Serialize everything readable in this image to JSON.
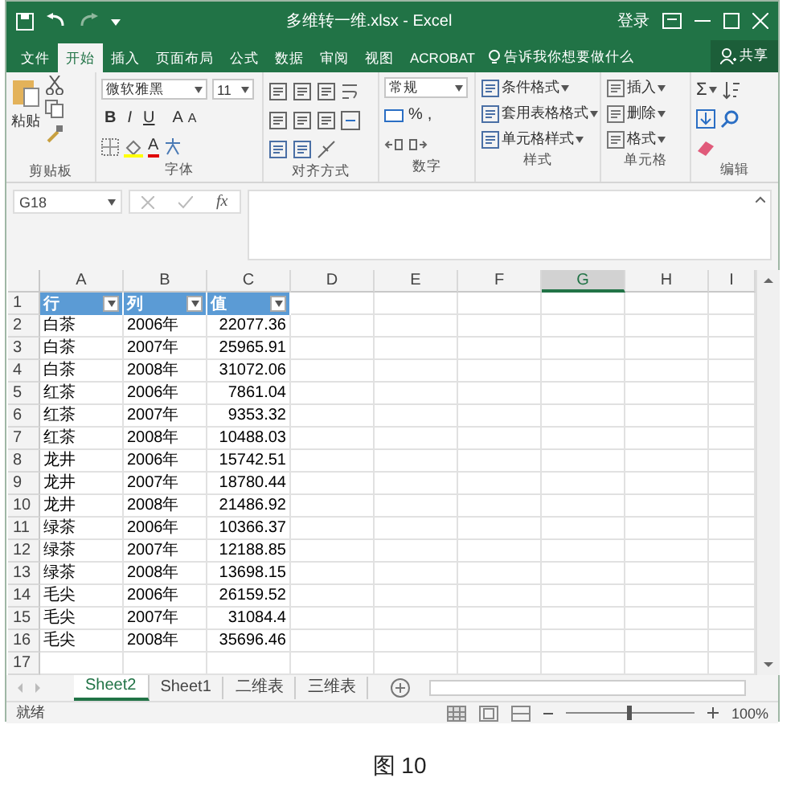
{
  "window": {
    "title": "多维转一维.xlsx - Excel",
    "sign_in": "登录"
  },
  "ribbon_tabs": [
    {
      "label": "文件",
      "selected": false
    },
    {
      "label": "开始",
      "selected": true
    },
    {
      "label": "插入",
      "selected": false
    },
    {
      "label": "页面布局",
      "selected": false
    },
    {
      "label": "公式",
      "selected": false
    },
    {
      "label": "数据",
      "selected": false
    },
    {
      "label": "审阅",
      "selected": false
    },
    {
      "label": "视图",
      "selected": false
    },
    {
      "label": "ACROBAT",
      "selected": false
    }
  ],
  "tell_me": "告诉我你想要做什么",
  "share": "共享",
  "ribbon": {
    "clipboard": {
      "paste": "粘贴",
      "label": "剪贴板"
    },
    "font": {
      "name": "微软雅黑",
      "size": "11",
      "styles": [
        "B",
        "I",
        "U"
      ],
      "grow": "A",
      "shrink": "A",
      "font_color_button": "A",
      "label": "字体"
    },
    "alignment": {
      "label": "对齐方式"
    },
    "number": {
      "format": "常规",
      "percent": "%",
      "comma": ",",
      "label": "数字"
    },
    "styles": {
      "items": [
        "条件格式",
        "套用表格格式",
        "单元格样式"
      ],
      "label": "样式"
    },
    "cells": {
      "items": [
        "插入",
        "删除",
        "格式"
      ],
      "label": "单元格"
    },
    "editing": {
      "sum": "Σ",
      "label": "编辑"
    }
  },
  "formula_bar": {
    "name_box": "G18",
    "fx": "fx"
  },
  "grid": {
    "columns": [
      {
        "label": "A",
        "selected": false
      },
      {
        "label": "B",
        "selected": false
      },
      {
        "label": "C",
        "selected": false
      },
      {
        "label": "D",
        "selected": false
      },
      {
        "label": "E",
        "selected": false
      },
      {
        "label": "F",
        "selected": false
      },
      {
        "label": "G",
        "selected": true
      },
      {
        "label": "H",
        "selected": false
      },
      {
        "label": "I",
        "selected": false
      }
    ],
    "row_numbers": [
      "1",
      "2",
      "3",
      "4",
      "5",
      "6",
      "7",
      "8",
      "9",
      "10",
      "11",
      "12",
      "13",
      "14",
      "15",
      "16",
      "17"
    ],
    "table_header": [
      "行",
      "列",
      "值"
    ],
    "table_rows": [
      [
        "白茶",
        "2006年",
        "22077.36"
      ],
      [
        "白茶",
        "2007年",
        "25965.91"
      ],
      [
        "白茶",
        "2008年",
        "31072.06"
      ],
      [
        "红茶",
        "2006年",
        "7861.04"
      ],
      [
        "红茶",
        "2007年",
        "9353.32"
      ],
      [
        "红茶",
        "2008年",
        "10488.03"
      ],
      [
        "龙井",
        "2006年",
        "15742.51"
      ],
      [
        "龙井",
        "2007年",
        "18780.44"
      ],
      [
        "龙井",
        "2008年",
        "21486.92"
      ],
      [
        "绿茶",
        "2006年",
        "10366.37"
      ],
      [
        "绿茶",
        "2007年",
        "12188.85"
      ],
      [
        "绿茶",
        "2008年",
        "13698.15"
      ],
      [
        "毛尖",
        "2006年",
        "26159.52"
      ],
      [
        "毛尖",
        "2007年",
        "31084.4"
      ],
      [
        "毛尖",
        "2008年",
        "35696.46"
      ]
    ]
  },
  "sheet_tabs": [
    {
      "label": "Sheet2",
      "selected": true
    },
    {
      "label": "Sheet1",
      "selected": false
    },
    {
      "label": "二维表",
      "selected": false
    },
    {
      "label": "三维表",
      "selected": false
    }
  ],
  "status_bar": {
    "status": "就绪",
    "zoom": "100%",
    "zoom_slider": {
      "level": 0.5
    }
  },
  "caption": "图 10"
}
